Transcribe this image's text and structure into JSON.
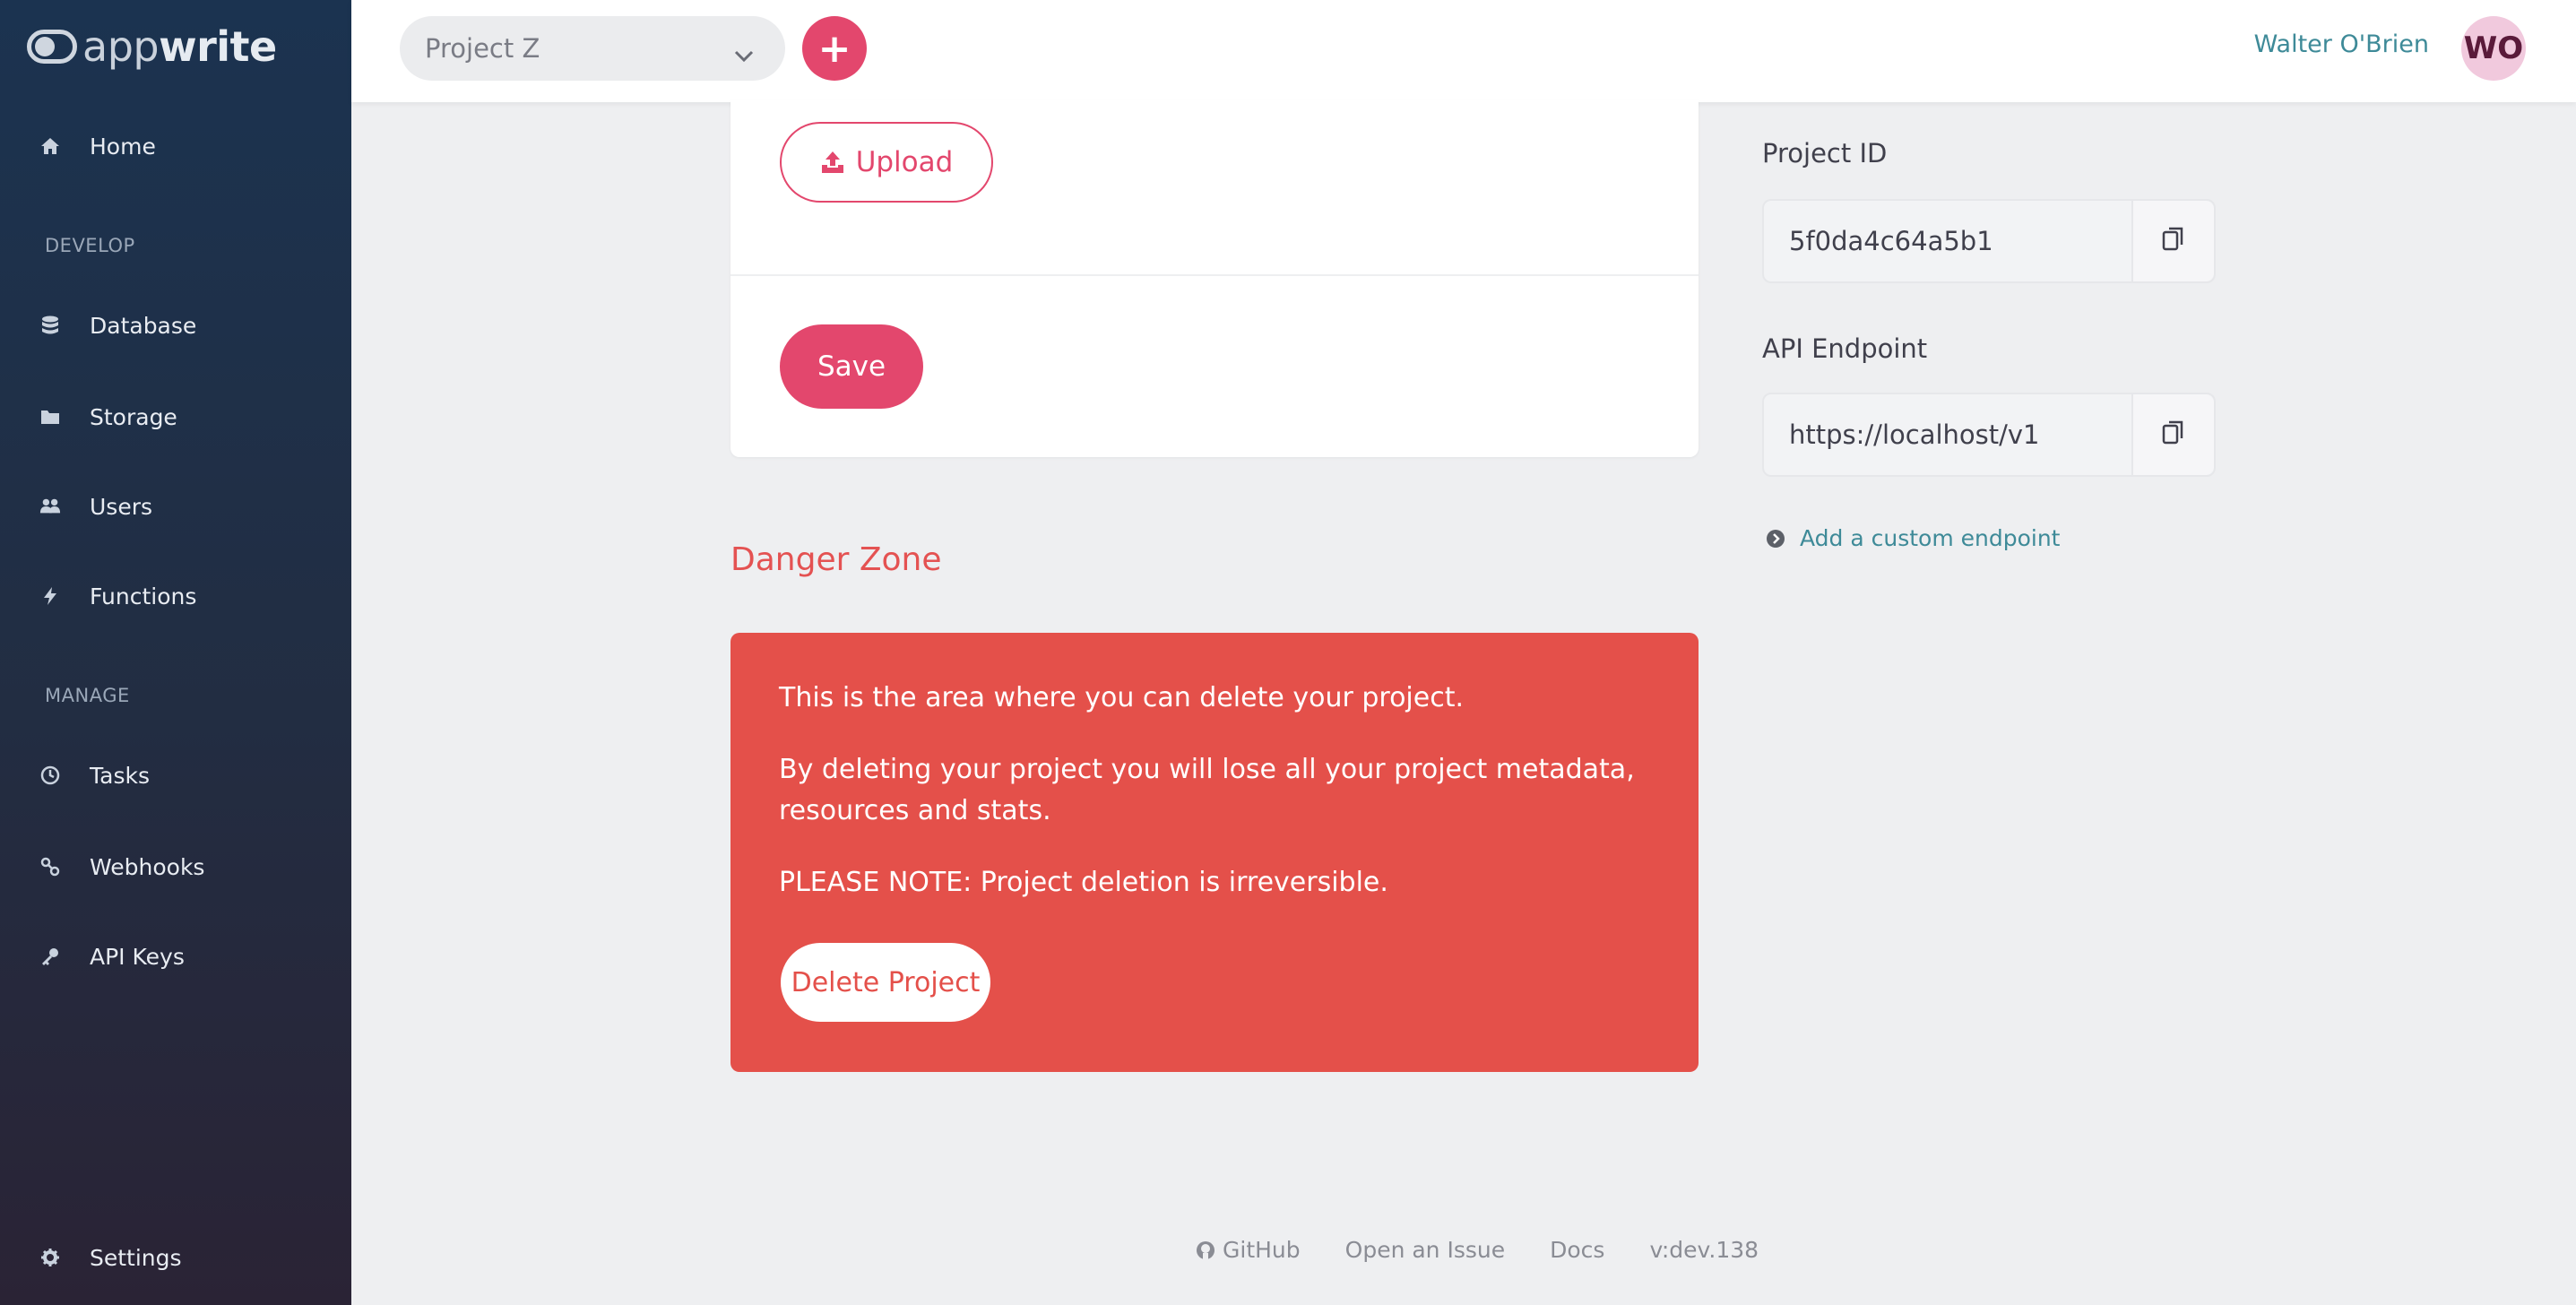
{
  "brand": {
    "name_light": "app",
    "name_bold": "write"
  },
  "sidebar": {
    "items": [
      {
        "label": "Home",
        "icon": "home-icon"
      },
      {
        "label": "Database",
        "icon": "database-icon"
      },
      {
        "label": "Storage",
        "icon": "folder-icon"
      },
      {
        "label": "Users",
        "icon": "users-icon"
      },
      {
        "label": "Functions",
        "icon": "bolt-icon"
      },
      {
        "label": "Tasks",
        "icon": "clock-icon"
      },
      {
        "label": "Webhooks",
        "icon": "link-icon"
      },
      {
        "label": "API Keys",
        "icon": "key-icon"
      },
      {
        "label": "Settings",
        "icon": "gear-icon"
      }
    ],
    "sections": {
      "develop": "DEVELOP",
      "manage": "MANAGE"
    }
  },
  "header": {
    "project": "Project Z",
    "add_symbol": "+",
    "user_name": "Walter O'Brien",
    "user_initials": "WO"
  },
  "form": {
    "upload_label": "Upload",
    "save_label": "Save"
  },
  "danger": {
    "title": "Danger Zone",
    "p1": "This is the area where you can delete your project.",
    "p2": "By deleting your project you will lose all your project metadata, resources and stats.",
    "p3": "PLEASE NOTE: Project deletion is irreversible.",
    "delete_label": "Delete Project"
  },
  "info": {
    "project_id_label": "Project ID",
    "project_id": "5f0da4c64a5b1",
    "endpoint_label": "API Endpoint",
    "endpoint": "https://localhost/v1",
    "custom_endpoint": "Add a custom endpoint"
  },
  "footer": {
    "github": "GitHub",
    "issue": "Open an Issue",
    "docs": "Docs",
    "version": "v:dev.138"
  },
  "colors": {
    "accent": "#e3476d",
    "danger": "#e4504a",
    "link": "#3e8a98"
  }
}
